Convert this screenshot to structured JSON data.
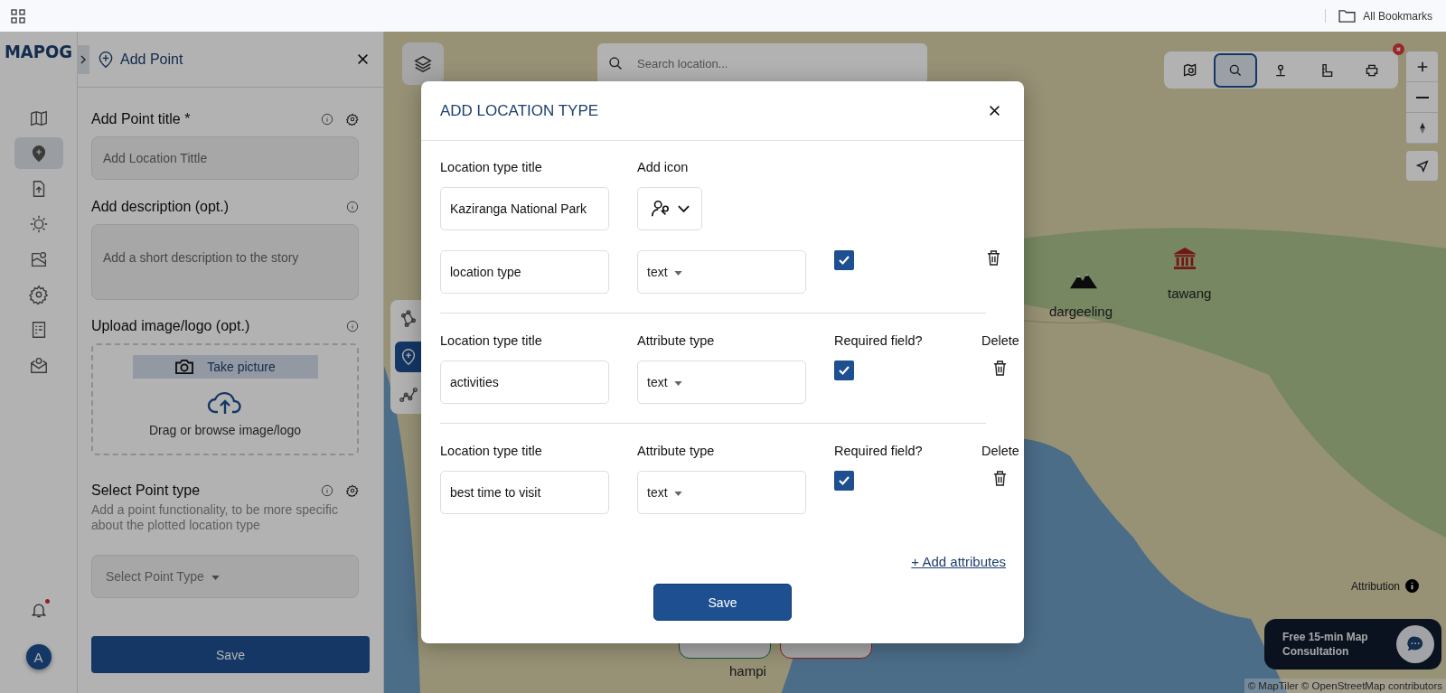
{
  "browser_bar": {
    "bookmarks_label": "All Bookmarks"
  },
  "rail": {
    "logo": "MAPOG",
    "items": [
      {
        "kind": "map",
        "selected": false
      },
      {
        "kind": "add-pin",
        "selected": true
      },
      {
        "kind": "upload",
        "selected": false
      },
      {
        "kind": "sun",
        "selected": false
      },
      {
        "kind": "map-pin",
        "selected": false
      },
      {
        "kind": "gear",
        "selected": false
      },
      {
        "kind": "report",
        "selected": false
      },
      {
        "kind": "mail-pin",
        "selected": false
      }
    ],
    "notification_unread": true,
    "avatar": "A"
  },
  "panel": {
    "title": "Add Point",
    "title_label": "Add Point title *",
    "title_placeholder": "Add Location Tittle",
    "description_label": "Add description (opt.)",
    "description_placeholder": "Add a short description to the story",
    "upload_label": "Upload image/logo (opt.)",
    "take_picture": "Take picture",
    "upload_hint": "Drag or browse image/logo",
    "point_type_label": "Select Point type",
    "point_type_help": "Add a point functionality, to be more specific about the plotted location type",
    "point_type_placeholder": "Select Point Type",
    "save": "Save"
  },
  "map": {
    "search_placeholder": "Search location...",
    "tools": [
      {
        "kind": "map-search",
        "selected": false
      },
      {
        "kind": "search",
        "selected": true
      },
      {
        "kind": "pin",
        "selected": false
      },
      {
        "kind": "ruler",
        "selected": false
      },
      {
        "kind": "printer",
        "selected": false
      }
    ],
    "side_tools": [
      {
        "kind": "polygon",
        "selected": false
      },
      {
        "kind": "add-pin",
        "selected": true
      },
      {
        "kind": "line",
        "selected": false
      }
    ],
    "markers": [
      {
        "kind": "mountain",
        "label": "dargeeling"
      },
      {
        "kind": "temple",
        "label": "tawang"
      },
      {
        "kind": "none",
        "label": "hampi"
      }
    ],
    "attribution_button": "Attribution",
    "consultation": "Free 15-min Map Consultation",
    "credits": "© MapTiler © OpenStreetMap contributors"
  },
  "modal": {
    "title": "ADD LOCATION TYPE",
    "type_title_label": "Location type title",
    "type_title_value": "Kaziranga National Park",
    "icon_label": "Add icon",
    "attributes": [
      {
        "value": "location type",
        "type": "text",
        "required": true
      },
      {
        "title_label": "Location type title",
        "type_label": "Attribute type",
        "required_label": "Required field?",
        "delete_label": "Delete",
        "value": "activities",
        "type": "text",
        "required": true
      },
      {
        "title_label": "Location type title",
        "type_label": "Attribute type",
        "required_label": "Required field?",
        "delete_label": "Delete",
        "value": "best time to visit",
        "type": "text",
        "required": true
      }
    ],
    "add_attributes": "+ Add attributes",
    "save": "Save"
  }
}
